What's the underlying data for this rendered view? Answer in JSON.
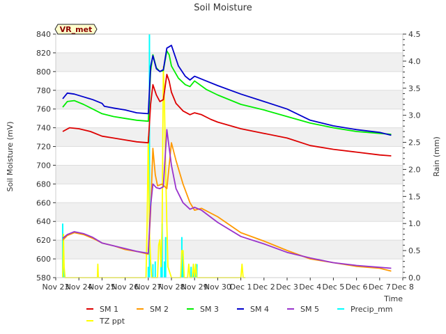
{
  "chart_data": {
    "type": "line",
    "title": "Soil Moisture",
    "badge": "VR_met",
    "xlabel": "Time",
    "ylabel": "Soil Moisture (mV)",
    "y2label": "Rain (mm)",
    "xlim": [
      0,
      15
    ],
    "ylim": [
      580,
      840
    ],
    "y2lim": [
      0,
      4.5
    ],
    "x_ticks": [
      0,
      1,
      2,
      3,
      4,
      5,
      6,
      7,
      8,
      9,
      10,
      11,
      12,
      13,
      14,
      15
    ],
    "x_tick_labels": [
      "Nov 23",
      "Nov 24",
      "Nov 25",
      "Nov 26",
      "Nov 27",
      "Nov 28",
      "Nov 29",
      "Nov 30",
      "Dec 1",
      "Dec 2",
      "Dec 3",
      "Dec 4",
      "Dec 5",
      "Dec 6",
      "Dec 7",
      "Dec 8"
    ],
    "y_ticks": [
      580,
      600,
      620,
      640,
      660,
      680,
      700,
      720,
      740,
      760,
      780,
      800,
      820,
      840
    ],
    "y2_ticks": [
      0.0,
      0.5,
      1.0,
      1.5,
      2.0,
      2.5,
      3.0,
      3.5,
      4.0,
      4.5
    ],
    "y2_tick_labels": [
      "0.0",
      "0.5",
      "1.0",
      "1.5",
      "2.0",
      "2.5",
      "3.0",
      "3.5",
      "4.0",
      "4.5"
    ],
    "grid": "horizontal bands",
    "legend_position": "bottom",
    "series": [
      {
        "name": "SM 1",
        "color": "#dd0000",
        "axis": "left",
        "x": [
          0.3,
          0.6,
          1.0,
          1.5,
          2.0,
          2.5,
          3.0,
          3.5,
          4.0,
          4.1,
          4.2,
          4.35,
          4.5,
          4.65,
          4.8,
          4.9,
          5.0,
          5.2,
          5.5,
          5.8,
          6.0,
          6.3,
          6.7,
          7.0,
          8.0,
          9.0,
          10.0,
          11.0,
          12.0,
          13.0,
          14.0,
          14.5
        ],
        "y": [
          736,
          740,
          739,
          736,
          731,
          729,
          727,
          725,
          724,
          765,
          786,
          775,
          768,
          770,
          797,
          790,
          778,
          766,
          758,
          754,
          756,
          754,
          749,
          746,
          739,
          734,
          729,
          721,
          717,
          714,
          711,
          710
        ]
      },
      {
        "name": "SM 2",
        "color": "#ff9900",
        "axis": "left",
        "x": [
          0.3,
          0.5,
          0.8,
          1.2,
          1.6,
          2.0,
          2.5,
          3.0,
          3.5,
          4.0,
          4.1,
          4.2,
          4.3,
          4.4,
          4.6,
          4.8,
          5.0,
          5.2,
          5.5,
          5.8,
          6.0,
          6.3,
          7.0,
          8.0,
          9.0,
          10.0,
          11.0,
          12.0,
          13.0,
          14.0,
          14.5
        ],
        "y": [
          620,
          625,
          628,
          626,
          622,
          617,
          614,
          610,
          608,
          605,
          650,
          718,
          690,
          678,
          680,
          675,
          724,
          705,
          680,
          660,
          652,
          654,
          645,
          628,
          619,
          609,
          600,
          596,
          592,
          590,
          587
        ]
      },
      {
        "name": "SM 3",
        "color": "#00ee00",
        "axis": "left",
        "x": [
          0.3,
          0.5,
          0.8,
          1.2,
          1.6,
          2.0,
          2.5,
          3.0,
          3.5,
          4.0,
          4.1,
          4.2,
          4.35,
          4.5,
          4.65,
          4.8,
          4.9,
          5.0,
          5.3,
          5.6,
          5.8,
          6.0,
          6.5,
          7.0,
          8.0,
          9.0,
          10.0,
          11.0,
          12.0,
          13.0,
          14.0,
          14.5
        ],
        "y": [
          762,
          768,
          769,
          765,
          760,
          755,
          752,
          750,
          748,
          747,
          800,
          818,
          804,
          800,
          801,
          822,
          818,
          806,
          793,
          786,
          784,
          790,
          781,
          775,
          765,
          759,
          752,
          745,
          740,
          736,
          734,
          733
        ]
      },
      {
        "name": "SM 4",
        "color": "#0000cc",
        "axis": "left",
        "x": [
          0.3,
          0.5,
          0.8,
          1.2,
          1.6,
          2.0,
          2.1,
          2.5,
          3.0,
          3.5,
          4.0,
          4.1,
          4.2,
          4.35,
          4.5,
          4.65,
          4.8,
          5.0,
          5.3,
          5.6,
          5.8,
          6.0,
          6.5,
          7.0,
          8.0,
          9.0,
          10.0,
          11.0,
          12.0,
          13.0,
          14.0,
          14.5
        ],
        "y": [
          771,
          777,
          776,
          773,
          770,
          766,
          763,
          761,
          759,
          756,
          755,
          805,
          817,
          803,
          800,
          802,
          825,
          828,
          806,
          795,
          791,
          795,
          790,
          785,
          776,
          768,
          760,
          748,
          742,
          738,
          735,
          732
        ]
      },
      {
        "name": "SM 5",
        "color": "#9933cc",
        "axis": "left",
        "x": [
          0.3,
          0.5,
          0.8,
          1.2,
          1.6,
          2.0,
          2.5,
          3.0,
          3.5,
          4.0,
          4.1,
          4.2,
          4.35,
          4.5,
          4.65,
          4.8,
          5.0,
          5.2,
          5.5,
          5.8,
          6.0,
          6.3,
          7.0,
          8.0,
          9.0,
          10.0,
          11.0,
          12.0,
          13.0,
          14.0,
          14.5
        ],
        "y": [
          622,
          626,
          629,
          627,
          623,
          617,
          614,
          611,
          608,
          606,
          656,
          680,
          676,
          675,
          677,
          738,
          700,
          675,
          660,
          653,
          655,
          652,
          639,
          624,
          616,
          607,
          601,
          596,
          593,
          591,
          590
        ]
      },
      {
        "name": "Precip_mm",
        "color": "#00ffff",
        "axis": "right",
        "kind": "bars",
        "x": [
          0.3,
          0.35,
          4.0,
          4.05,
          4.2,
          4.3,
          4.55,
          4.6,
          4.7,
          4.75,
          5.45,
          5.5,
          5.85,
          5.95,
          6.05,
          6.1
        ],
        "y": [
          1.0,
          0.25,
          0.2,
          4.5,
          0.25,
          0.3,
          0.25,
          1.0,
          0.3,
          0.75,
          0.75,
          0.5,
          0.2,
          0.25,
          0.25,
          0.25
        ]
      },
      {
        "name": "TZ ppt",
        "color": "#ffff00",
        "axis": "right",
        "x": [
          0.3,
          0.33,
          0.36,
          0.4,
          0.5,
          1.8,
          1.82,
          1.84,
          1.9,
          3.9,
          3.95,
          4.0,
          4.05,
          4.1,
          4.15,
          4.2,
          4.4,
          4.45,
          4.5,
          4.55,
          4.6,
          4.65,
          4.7,
          4.75,
          4.8,
          4.85,
          5.0,
          5.4,
          5.45,
          5.5,
          5.55,
          5.7,
          5.75,
          5.8,
          5.9,
          5.95,
          6.0,
          6.05,
          6.1,
          6.2,
          8.0,
          8.05,
          8.1,
          8.2
        ],
        "y": [
          0,
          0.8,
          0.2,
          0,
          0,
          0,
          0.25,
          0,
          0,
          0,
          1.0,
          2.6,
          0.8,
          0.3,
          0,
          0,
          0,
          0.6,
          0.7,
          0.2,
          1.0,
          3.9,
          3.2,
          2.0,
          1.0,
          0.2,
          0,
          0,
          0.5,
          0.5,
          0,
          0,
          0.25,
          0,
          0,
          0.25,
          0,
          0.25,
          0,
          0,
          0,
          0.25,
          0,
          0
        ]
      }
    ]
  }
}
